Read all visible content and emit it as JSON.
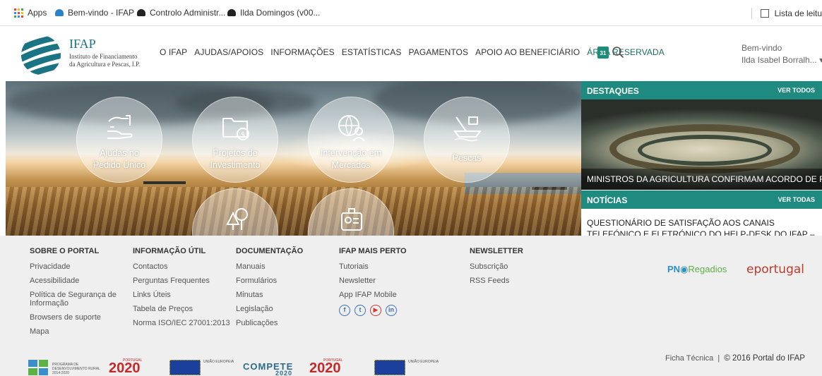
{
  "bookmarks": {
    "items": [
      {
        "label": "Apps",
        "icon": "apps-grid-icon"
      },
      {
        "label": "Bem-vindo - IFAP",
        "icon": "ifap-favicon"
      },
      {
        "label": "Controlo Administr...",
        "icon": "site-favicon"
      },
      {
        "label": "Ilda Domingos (v00...",
        "icon": "site-favicon"
      }
    ],
    "reading_list": "Lista de leitu"
  },
  "header": {
    "logo_title": "IFAP",
    "logo_sub_line1": "Instituto de Financiamento",
    "logo_sub_line2": "da Agricultura e Pescas, I.P.",
    "nav": [
      "O IFAP",
      "AJUDAS/APOIOS",
      "INFORMAÇÕES",
      "ESTATÍSTICAS",
      "PAGAMENTOS",
      "APOIO AO BENEFICIÁRIO",
      "ÁREA RESERVADA"
    ],
    "calendar_day": "31",
    "welcome_label": "Bem-vindo",
    "user_name": "Ilda Isabel Borralh..."
  },
  "hero": {
    "circles": [
      {
        "line1": "Ajudas no",
        "line2": "Pedido Único",
        "icon": "hand-document-icon"
      },
      {
        "line1": "Projetos de",
        "line2": "Investimento",
        "icon": "folder-money-icon"
      },
      {
        "line1": "Intervenção em",
        "line2": "Mercados",
        "icon": "globe-person-icon"
      },
      {
        "line1": "Pescas",
        "line2": "",
        "icon": "fishing-boat-icon"
      },
      {
        "line1": "",
        "line2": "",
        "icon": "trees-icon"
      },
      {
        "line1": "",
        "line2": "",
        "icon": "id-card-icon"
      }
    ]
  },
  "right_panel": {
    "destaques_title": "DESTAQUES",
    "destaques_more": "VER TODOS",
    "destaque_caption": "MINISTROS DA AGRICULTURA CONFIRMAM ACORDO DE R...",
    "noticias_title": "NOTÍCIAS",
    "noticias_more": "VER TODAS",
    "news_text": "QUESTIONÁRIO DE SATISFAÇÃO AOS CANAIS TELEFÓNICO E ELETRÓNICO DO HELP-DESK DO IFAP – AGRADECIMENTO"
  },
  "footer": {
    "columns": [
      {
        "heading": "SOBRE O PORTAL",
        "items": [
          "Privacidade",
          "Acessibilidade",
          "Política de Segurança de Informação",
          "Browsers de suporte",
          "Mapa"
        ]
      },
      {
        "heading": "INFORMAÇÃO ÚTIL",
        "items": [
          "Contactos",
          "Perguntas Frequentes",
          "Links Úteis",
          "Tabela de Preços",
          "Norma ISO/IEC 27001:2013"
        ]
      },
      {
        "heading": "DOCUMENTAÇÃO",
        "items": [
          "Manuais",
          "Formulários",
          "Minutas",
          "Legislação",
          "Publicações"
        ]
      },
      {
        "heading": "IFAP MAIS PERTO",
        "items": [
          "Tutoriais",
          "Newsletter",
          "App IFAP Mobile"
        ]
      },
      {
        "heading": "NEWSLETTER",
        "items": [
          "Subscrição",
          "RSS Feeds"
        ]
      }
    ],
    "social": [
      "f",
      "t",
      "▶",
      "in"
    ],
    "pnr_prefix": "PN",
    "pnr_suffix": "Regadios",
    "eportugal": "eportugal",
    "ficha_tecnica": "Ficha Técnica",
    "copyright": "© 2016 Portal do IFAP",
    "funding": {
      "pdr_text": "PROGRAMA DE DESENVOLVIMENTO RURAL 2014-2020",
      "portugal2020": "2020",
      "portugal_label": "PORTUGAL",
      "eu_label": "UNIÃO EUROPEIA",
      "compete": "COMPETE",
      "compete_year": "2020"
    }
  }
}
